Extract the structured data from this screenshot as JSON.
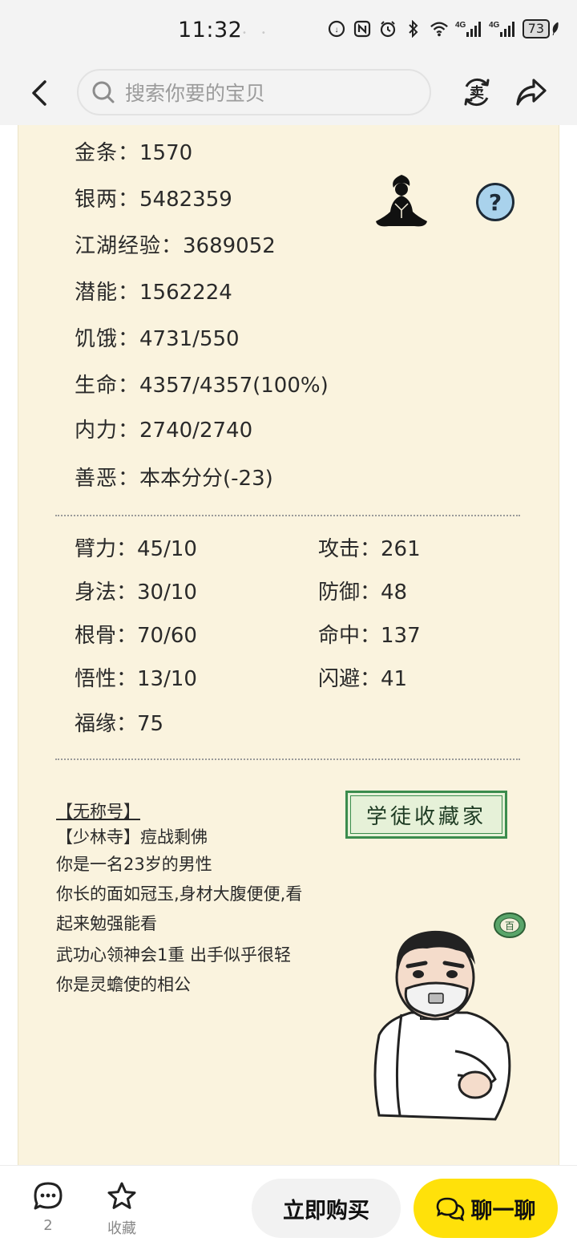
{
  "status_bar": {
    "time": "11:32",
    "network_1": "4G",
    "network_2": "4G",
    "battery": "73"
  },
  "header": {
    "search_placeholder": "搜索你要的宝贝",
    "sell_icon": "sell-icon",
    "share_icon": "share-icon"
  },
  "stats": {
    "gold": {
      "label": "金条：",
      "value": "1570"
    },
    "silver": {
      "label": "银两：",
      "value": "5482359"
    },
    "exp": {
      "label": "江湖经验：",
      "value": "3689052"
    },
    "potential": {
      "label": "潜能：",
      "value": "1562224"
    },
    "hunger": {
      "label": "饥饿：",
      "value": "4731/550"
    },
    "life": {
      "label": "生命：",
      "value": "4357/4357(100%)"
    },
    "inner": {
      "label": "内力：",
      "value": "2740/2740"
    },
    "morality": {
      "label": "善恶：",
      "value": "本本分分(-23)"
    }
  },
  "attributes": {
    "arm": {
      "label": "臂力：",
      "value": "45/10"
    },
    "agility": {
      "label": "身法：",
      "value": "30/10"
    },
    "bone": {
      "label": "根骨：",
      "value": "70/60"
    },
    "insight": {
      "label": "悟性：",
      "value": "13/10"
    },
    "luck": {
      "label": "福缘：",
      "value": "75"
    },
    "attack": {
      "label": "攻击：",
      "value": "261"
    },
    "defense": {
      "label": "防御：",
      "value": "48"
    },
    "hit": {
      "label": "命中：",
      "value": "137"
    },
    "dodge": {
      "label": "闪避：",
      "value": "41"
    }
  },
  "bio": {
    "title": "【无称号】",
    "sect": "【少林寺】痘战剩佛",
    "line1": "你是一名23岁的男性",
    "line2": "你长的面如冠玉,身材大腹便便,看",
    "line3": "起来勉强能看",
    "line4": "武功心领神会1重 出手似乎很轻",
    "line5": "你是灵蟾使的相公"
  },
  "badge": {
    "text": "学徒收藏家"
  },
  "seal": {
    "text": "百"
  },
  "help": {
    "text": "?"
  },
  "bottom_bar": {
    "comment_count": "2",
    "favorite_label": "收藏",
    "buy_label": "立即购买",
    "chat_label": "聊一聊"
  },
  "colors": {
    "panel_bg": "#faf3de",
    "chat_button": "#ffe10a",
    "badge_green": "#3b8c4d",
    "help_blue": "#a9d2ec"
  }
}
